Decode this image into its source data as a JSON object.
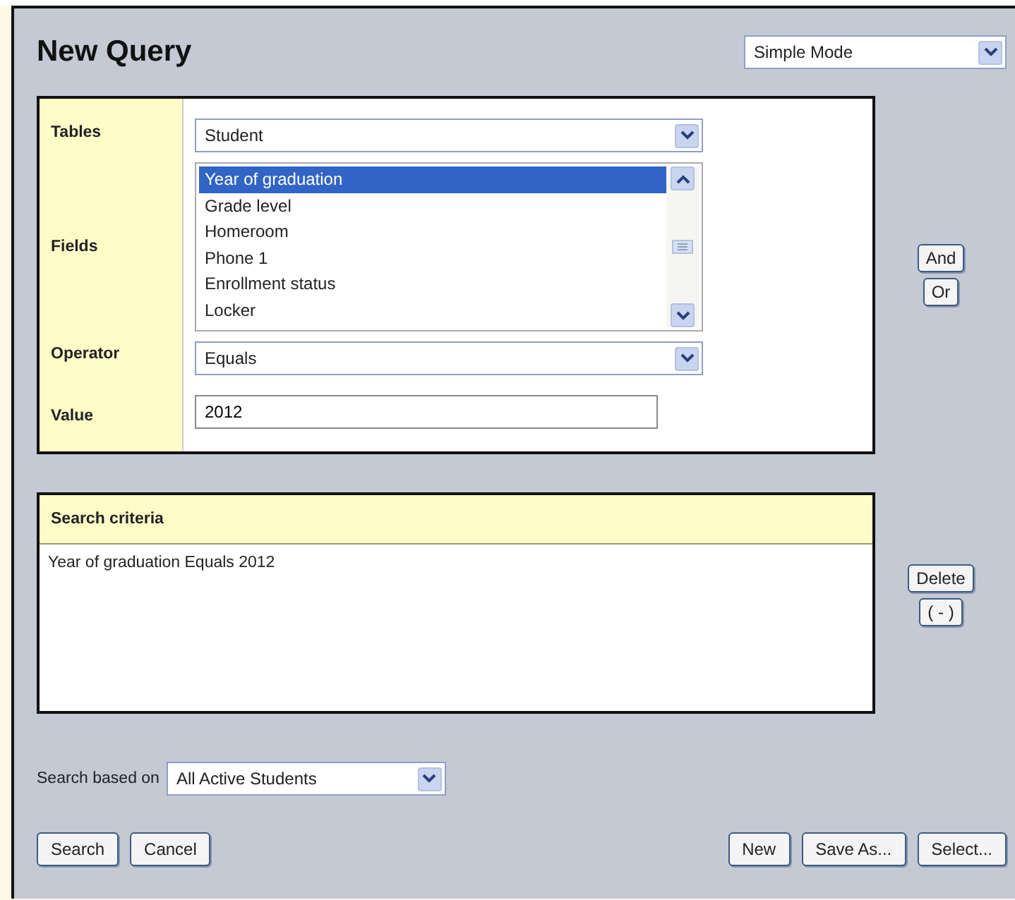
{
  "title": "New Query",
  "mode_select": {
    "value": "Simple Mode"
  },
  "query": {
    "tables": {
      "label": "Tables",
      "value": "Student"
    },
    "fields": {
      "label": "Fields",
      "items": [
        {
          "label": "Year of graduation",
          "selected": true
        },
        {
          "label": "Grade level",
          "selected": false
        },
        {
          "label": "Homeroom",
          "selected": false
        },
        {
          "label": "Phone 1",
          "selected": false
        },
        {
          "label": "Enrollment status",
          "selected": false
        },
        {
          "label": "Locker",
          "selected": false
        }
      ]
    },
    "operator": {
      "label": "Operator",
      "value": "Equals"
    },
    "value": {
      "label": "Value",
      "value": "2012"
    }
  },
  "logic_buttons": [
    "And",
    "Or"
  ],
  "criteria": {
    "heading": "Search criteria",
    "items": [
      "Year of graduation Equals 2012"
    ]
  },
  "criteria_buttons": [
    "Delete",
    "( - )"
  ],
  "search_based_on": {
    "label": "Search based on",
    "value": "All Active Students"
  },
  "left_buttons": [
    "Search",
    "Cancel"
  ],
  "right_buttons": [
    "New",
    "Save As...",
    "Select..."
  ]
}
